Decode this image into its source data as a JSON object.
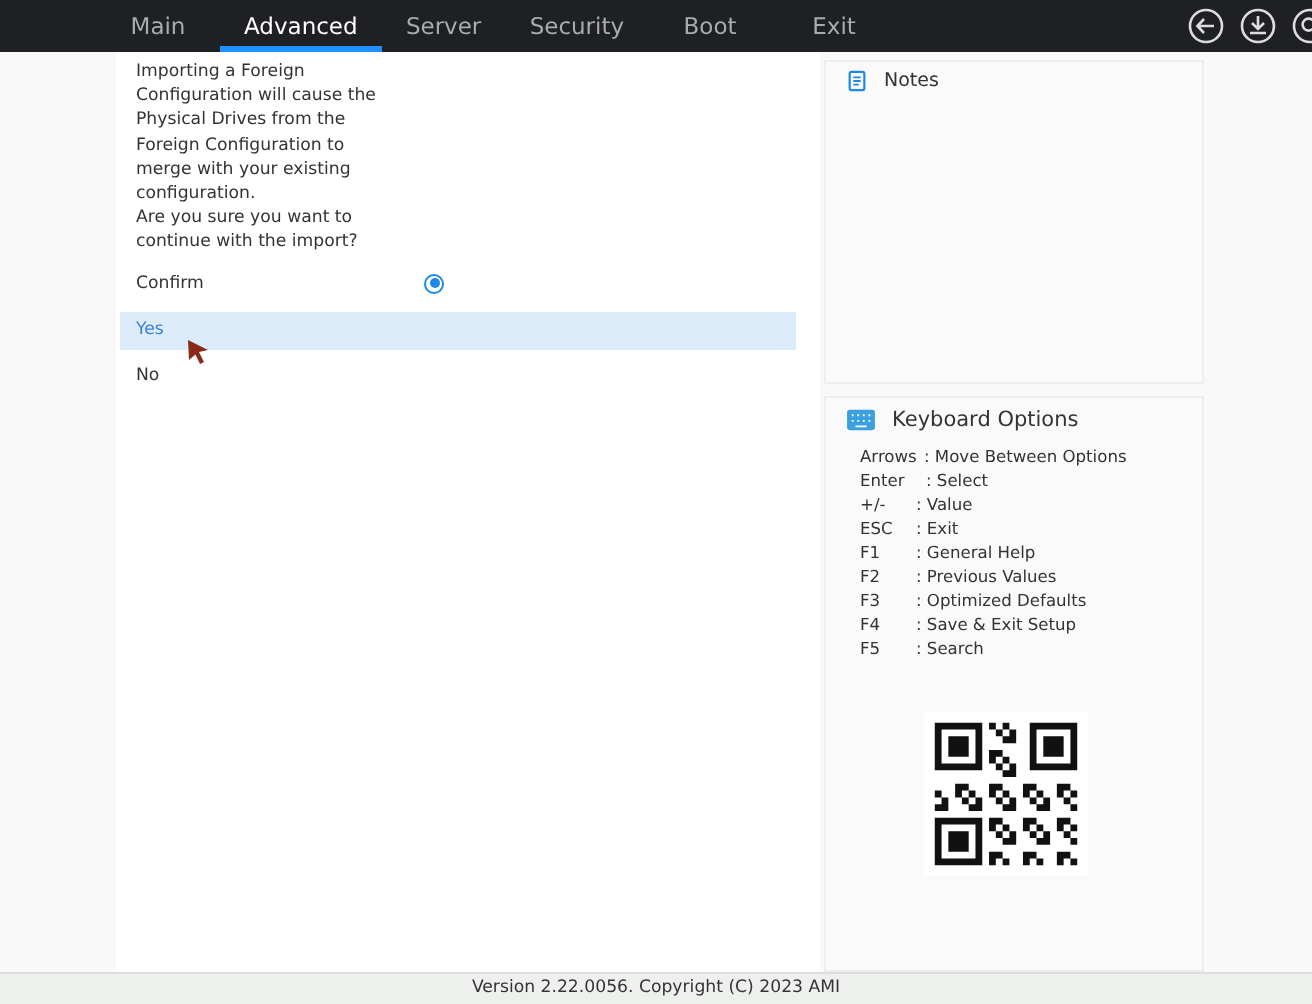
{
  "tabs": [
    {
      "label": "Main",
      "selected": false
    },
    {
      "label": "Advanced",
      "selected": true
    },
    {
      "label": "Server",
      "selected": false
    },
    {
      "label": "Security",
      "selected": false
    },
    {
      "label": "Boot",
      "selected": false
    },
    {
      "label": "Exit",
      "selected": false
    }
  ],
  "message": "Importing a Foreign Configuration will cause the Physical Drives from the Foreign Configuration to merge with your existing configuration.\nAre you sure you want to continue with the import?",
  "confirm": {
    "label": "Confirm",
    "checked": true
  },
  "options": [
    {
      "label": "Yes",
      "selected": true
    },
    {
      "label": "No",
      "selected": false
    }
  ],
  "notes": {
    "title": "Notes"
  },
  "keyboard": {
    "title": "Keyboard Options",
    "keys": [
      {
        "key": "Arrows",
        "action": ": Move Between Options"
      },
      {
        "key": "Enter",
        "action": ": Select"
      },
      {
        "key": "+/-",
        "action": ": Value"
      },
      {
        "key": "ESC",
        "action": ": Exit"
      },
      {
        "key": "F1",
        "action": ": General Help"
      },
      {
        "key": "F2",
        "action": ": Previous Values"
      },
      {
        "key": "F3",
        "action": ": Optimized Defaults"
      },
      {
        "key": "F4",
        "action": ": Save & Exit Setup"
      },
      {
        "key": "F5",
        "action": ": Search"
      }
    ]
  },
  "status_bar": "Version 2.22.0056. Copyright (C) 2023 AMI"
}
